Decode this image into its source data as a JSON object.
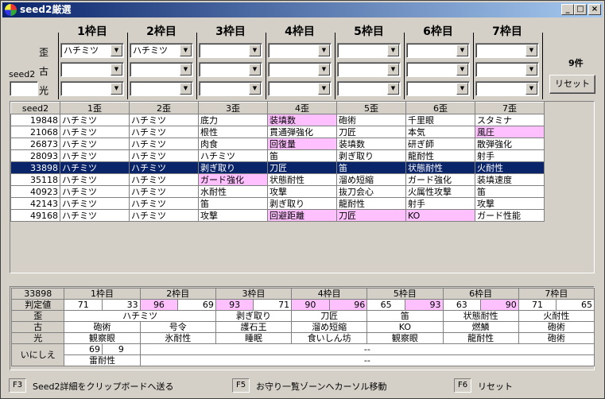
{
  "window": {
    "title": "seed2厳選",
    "min": "_",
    "max": "□",
    "close": "×"
  },
  "headers": [
    "1枠目",
    "2枠目",
    "3枠目",
    "4枠目",
    "5枠目",
    "6枠目",
    "7枠目"
  ],
  "row_labels": [
    "歪",
    "古",
    "光"
  ],
  "combos": {
    "r0": [
      "ハチミツ",
      "ハチミツ",
      "",
      "",
      "",
      "",
      ""
    ],
    "r1": [
      "",
      "",
      "",
      "",
      "",
      "",
      ""
    ],
    "r2": [
      "",
      "",
      "",
      "",
      "",
      "",
      ""
    ]
  },
  "seed_label": "seed2",
  "count": "9件",
  "reset_label": "リセット",
  "list_headers": [
    "seed2",
    "1歪",
    "2歪",
    "3歪",
    "4歪",
    "5歪",
    "6歪",
    "7歪"
  ],
  "list_rows": [
    {
      "seed": "19848",
      "c": [
        "ハチミツ",
        "ハチミツ",
        "底力",
        "装填数",
        "砲術",
        "千里眼",
        "スタミナ"
      ],
      "pink": [
        3
      ]
    },
    {
      "seed": "21068",
      "c": [
        "ハチミツ",
        "ハチミツ",
        "根性",
        "貫通弾強化",
        "刀匠",
        "本気",
        "風圧"
      ],
      "pink": [
        6
      ]
    },
    {
      "seed": "26873",
      "c": [
        "ハチミツ",
        "ハチミツ",
        "肉食",
        "回復量",
        "装填数",
        "研ぎ師",
        "散弾強化"
      ],
      "pink": [
        3
      ]
    },
    {
      "seed": "28093",
      "c": [
        "ハチミツ",
        "ハチミツ",
        "ハチミツ",
        "笛",
        "剥ぎ取り",
        "龍耐性",
        "射手"
      ],
      "pink": []
    },
    {
      "seed": "33898",
      "c": [
        "ハチミツ",
        "ハチミツ",
        "剥ぎ取り",
        "刀匠",
        "笛",
        "状態耐性",
        "火耐性"
      ],
      "pink": [],
      "selected": true
    },
    {
      "seed": "35118",
      "c": [
        "ハチミツ",
        "ハチミツ",
        "ガード強化",
        "状態耐性",
        "溜め短縮",
        "ガード強化",
        "装填速度"
      ],
      "pink": [
        2
      ]
    },
    {
      "seed": "40923",
      "c": [
        "ハチミツ",
        "ハチミツ",
        "水耐性",
        "攻撃",
        "抜刀会心",
        "火属性攻撃",
        "笛"
      ],
      "pink": []
    },
    {
      "seed": "42143",
      "c": [
        "ハチミツ",
        "ハチミツ",
        "笛",
        "剥ぎ取り",
        "龍耐性",
        "射手",
        "攻撃"
      ],
      "pink": []
    },
    {
      "seed": "49168",
      "c": [
        "ハチミツ",
        "ハチミツ",
        "攻撃",
        "回避距離",
        "刀匠",
        "KO",
        "ガード性能"
      ],
      "pink": [
        3,
        4,
        5
      ]
    }
  ],
  "detail": {
    "seed": "33898",
    "headers": [
      "1枠目",
      "2枠目",
      "3枠目",
      "4枠目",
      "5枠目",
      "6枠目",
      "7枠目"
    ],
    "hantei_label": "判定値",
    "hantei": [
      [
        "71",
        "33"
      ],
      [
        "96",
        "69"
      ],
      [
        "93",
        "71"
      ],
      [
        "90",
        "96"
      ],
      [
        "65",
        "93"
      ],
      [
        "63",
        "90"
      ],
      [
        "71",
        "65"
      ]
    ],
    "hantei_pink": [
      [
        false,
        false
      ],
      [
        true,
        false
      ],
      [
        true,
        false
      ],
      [
        true,
        true
      ],
      [
        false,
        true
      ],
      [
        false,
        true
      ],
      [
        false,
        false
      ]
    ],
    "yugami_label": "歪",
    "yugami_merged": "ハチミツ",
    "yugami": [
      "剥ぎ取り",
      "刀匠",
      "笛",
      "状態耐性",
      "火耐性"
    ],
    "furu_label": "古",
    "furu": [
      "砲術",
      "号令",
      "護石王",
      "溜め短縮",
      "KO",
      "燃鱗",
      "砲術"
    ],
    "hikari_label": "光",
    "hikari": [
      "観察眼",
      "氷耐性",
      "睡眠",
      "食いしん坊",
      "観察眼",
      "龍耐性",
      "砲術"
    ],
    "inishie_label": "いにしえ",
    "inishie_v1": "69",
    "inishie_v2": "9",
    "inishie_dash1": "--",
    "inishie_skill": "雷耐性",
    "inishie_dash2": "--"
  },
  "fkeys": [
    {
      "key": "F3",
      "label": "Seed2詳細をクリップボードへ送る"
    },
    {
      "key": "F5",
      "label": "お守り一覧ゾーンへカーソル移動"
    },
    {
      "key": "F6",
      "label": "リセット"
    }
  ]
}
